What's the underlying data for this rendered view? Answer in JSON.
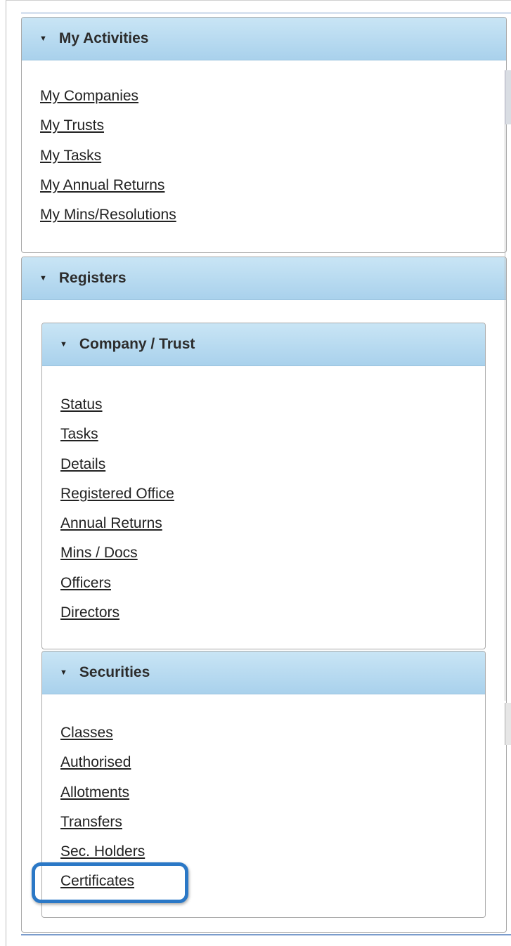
{
  "my_activities": {
    "title": "My Activities",
    "links": [
      "My Companies",
      "My Trusts",
      "My Tasks",
      "My Annual Returns",
      "My Mins/Resolutions"
    ]
  },
  "registers": {
    "title": "Registers",
    "company_trust": {
      "title": "Company / Trust",
      "links": [
        "Status",
        "Tasks",
        "Details",
        "Registered Office",
        "Annual Returns",
        "Mins / Docs",
        "Officers",
        "Directors"
      ]
    },
    "securities": {
      "title": "Securities",
      "links": [
        "Classes",
        "Authorised",
        "Allotments",
        "Transfers",
        "Sec. Holders",
        "Certificates"
      ]
    }
  },
  "header_color": "#b7dbf1",
  "highlight_color": "#2b78c6",
  "collapse_icon": "triangle-down-icon"
}
